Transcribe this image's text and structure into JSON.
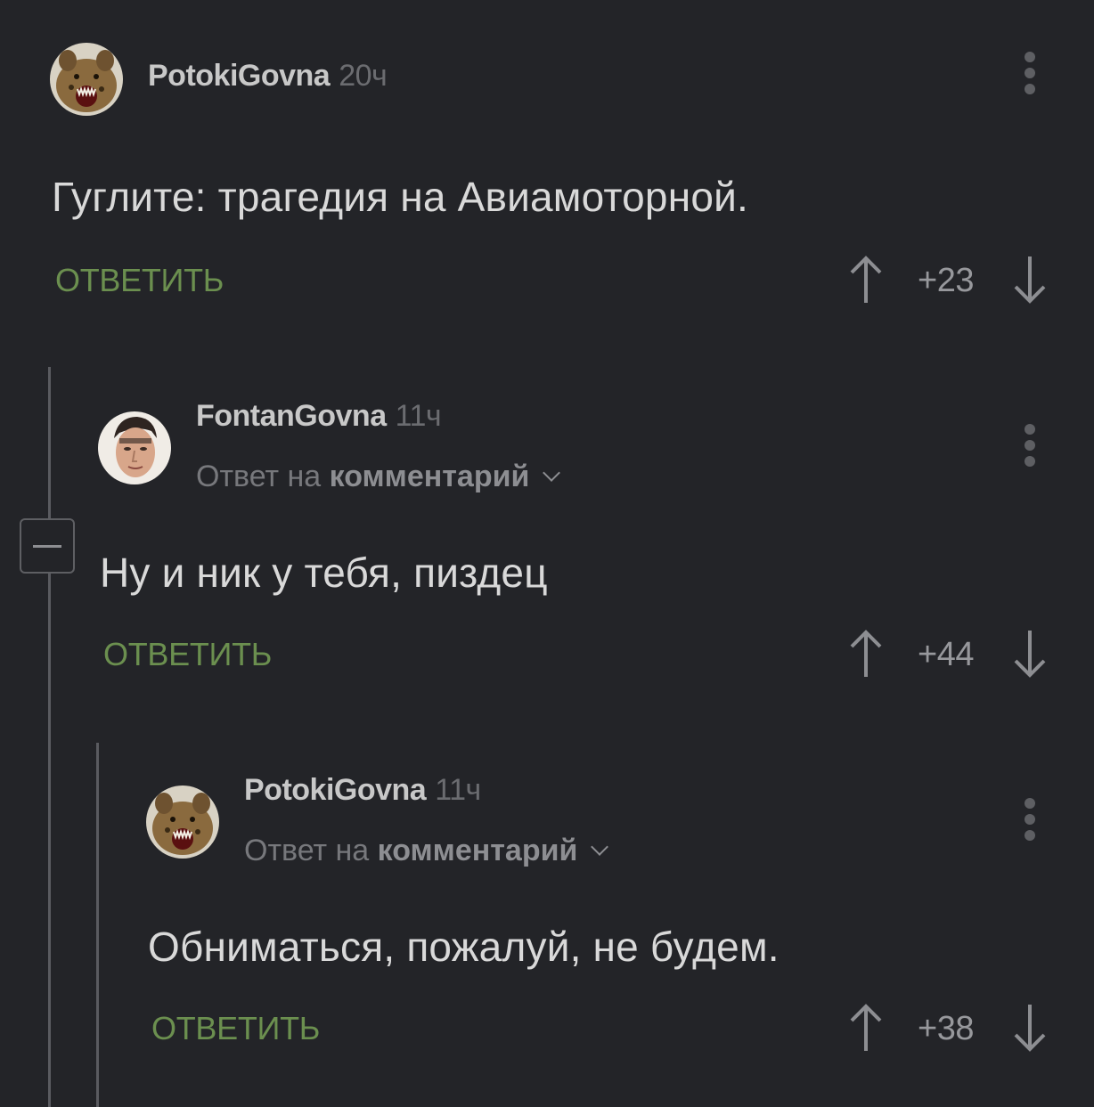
{
  "comments": [
    {
      "username": "PotokiGovna",
      "time": "20ч",
      "text": "Гуглите: трагедия на Авиамоторной.",
      "reply_label": "ОТВЕТИТЬ",
      "score": "+23"
    },
    {
      "username": "FontanGovna",
      "time": "11ч",
      "reply_to_prefix": "Ответ на",
      "reply_to_link": "комментарий",
      "text": "Ну и ник у тебя, пиздец",
      "reply_label": "ОТВЕТИТЬ",
      "score": "+44"
    },
    {
      "username": "PotokiGovna",
      "time": "11ч",
      "reply_to_prefix": "Ответ на",
      "reply_to_link": "комментарий",
      "text": "Обниматься, пожалуй, не будем.",
      "reply_label": "ОТВЕТИТЬ",
      "score": "+38"
    }
  ],
  "colors": {
    "background": "#232428",
    "reply_button": "#6b8f4f",
    "thread_line": "#5a5b60"
  },
  "icons": {
    "more": "kebab-menu-icon",
    "upvote": "arrow-up-icon",
    "downvote": "arrow-down-icon",
    "collapse": "minus-box-icon"
  }
}
